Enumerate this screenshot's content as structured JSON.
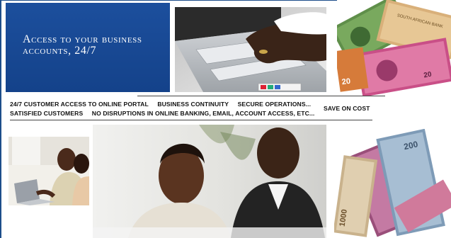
{
  "banner": {
    "headline": "Access to your business\naccounts, 24/7"
  },
  "strip": {
    "line1": [
      "24/7 CUSTOMER ACCESS TO ONLINE PORTAL",
      "BUSINESS CONTINUITY",
      "SECURE OPERATIONS..."
    ],
    "line2": [
      "SATISFIED CUSTOMERS",
      "NO DISRUPTIONS IN ONLINE BANKING, EMAIL, ACCOUNT ACCESS, ETC..."
    ],
    "save_on_cost": "SAVE ON COST"
  },
  "banknote_prints": {
    "south_african_bank": "SOUTH AFRICAN BANK",
    "note_20": "20",
    "note_200": "200",
    "note_1000": "1000"
  },
  "colors": {
    "banner_blue": "#1c4f9d",
    "frame_blue": "#1d4d8a",
    "text_dark": "#111111"
  }
}
